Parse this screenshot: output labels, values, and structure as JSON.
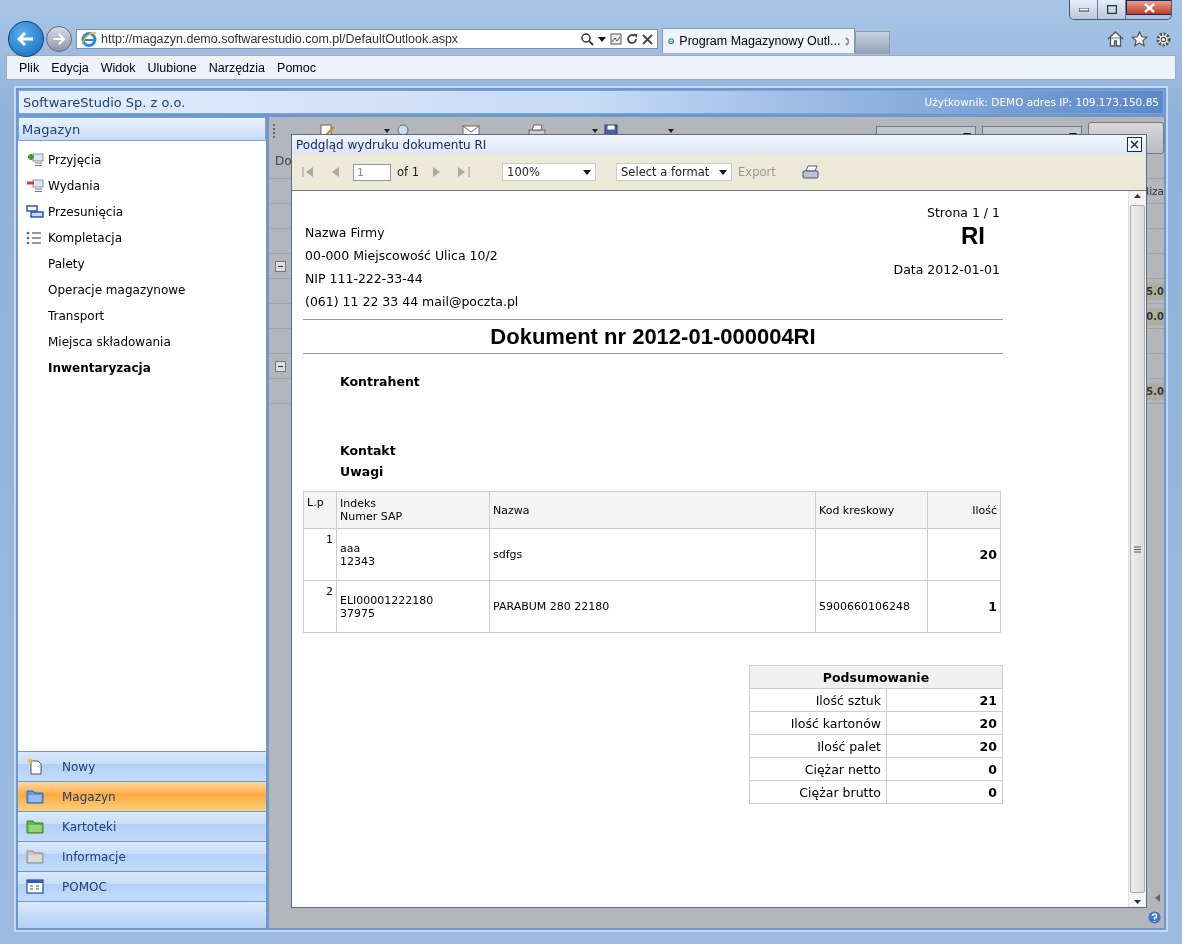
{
  "browser": {
    "address": "http://magazyn.demo.softwarestudio.com.pl/DefaultOutlook.aspx",
    "tab": {
      "title": "Program Magazynowy Outl..."
    },
    "menu": [
      "Plik",
      "Edycja",
      "Widok",
      "Ulubione",
      "Narzędzia",
      "Pomoc"
    ]
  },
  "app": {
    "company": "SoftwareStudio Sp. z o.o.",
    "user_info": "Użytkownik: DEMO adres IP: 109.173.150.85"
  },
  "sidebar": {
    "title": "Magazyn",
    "items": [
      {
        "label": "Przyjęcia",
        "kind": "add",
        "selected": false
      },
      {
        "label": "Wydania",
        "kind": "remove",
        "selected": false
      },
      {
        "label": "Przesunięcia",
        "kind": "move",
        "selected": false
      },
      {
        "label": "Kompletacja",
        "kind": "list",
        "selected": false
      },
      {
        "label": "Palety",
        "kind": "plain",
        "selected": false
      },
      {
        "label": "Operacje magazynowe",
        "kind": "plain",
        "selected": false
      },
      {
        "label": "Transport",
        "kind": "plain",
        "selected": false
      },
      {
        "label": "Miejsca składowania",
        "kind": "plain",
        "selected": false
      },
      {
        "label": "Inwentaryzacja",
        "kind": "plain",
        "selected": true
      }
    ]
  },
  "nav_buttons": [
    {
      "label": "Nowy",
      "kind": "new",
      "selected": false
    },
    {
      "label": "Magazyn",
      "kind": "folder_blue",
      "selected": true
    },
    {
      "label": "Kartoteki",
      "kind": "folder_green",
      "selected": false
    },
    {
      "label": "Informacje",
      "kind": "folder_grey",
      "selected": false
    },
    {
      "label": "POMOC",
      "kind": "window",
      "selected": false
    }
  ],
  "toolbar": {
    "items": [
      {
        "kind": "edit",
        "dropdown": true
      },
      {
        "kind": "preview",
        "dropdown": false
      },
      {
        "kind": "mail",
        "dropdown": false
      },
      {
        "kind": "print",
        "dropdown": true
      },
      {
        "kind": "save",
        "dropdown": true
      }
    ]
  },
  "grid": {
    "header": "Do",
    "header_right": "liza",
    "rows": [
      {
        "kind": "blank"
      },
      {
        "kind": "blank"
      },
      {
        "kind": "group"
      },
      {
        "kind": "value",
        "value": "5.0"
      },
      {
        "kind": "value",
        "value": "0.0"
      },
      {
        "kind": "blank"
      },
      {
        "kind": "group"
      },
      {
        "kind": "value",
        "value": "5.0"
      }
    ]
  },
  "dialog": {
    "title": "Podgląd wydruku dokumentu RI",
    "page": "1",
    "page_count": "of 1",
    "zoom": "100%",
    "format": "Select a format",
    "export": {
      "label": "Export",
      "disabled": true
    },
    "report": {
      "page_label": "Strona 1 / 1",
      "company_lines": [
        "Nazwa Firmy",
        "00-000 Miejscowość Ulica 10/2",
        "NIP 111-222-33-44",
        "(061) 11 22 33 44 mail@poczta.pl"
      ],
      "doc_type": "RI",
      "date": "Data 2012-01-01",
      "heading": "Dokument nr 2012-01-000004RI",
      "labels": [
        "Kontrahent",
        "Kontakt",
        "Uwagi"
      ],
      "columns": [
        {
          "lines": [
            "L.p"
          ]
        },
        {
          "lines": [
            "Indeks",
            "Numer SAP"
          ]
        },
        {
          "lines": [
            "Nazwa"
          ]
        },
        {
          "lines": [
            "Kod kreskowy"
          ]
        },
        {
          "lines": [
            "Ilość"
          ]
        }
      ],
      "rows": [
        {
          "lp": "1",
          "index": "aaa",
          "sap": "12343",
          "name": "sdfgs",
          "qty": "20"
        },
        {
          "lp": "2",
          "index": "ELI00001222180",
          "sap": "37975",
          "name": "PARABUM 280 22180",
          "barcode": "5900660106248",
          "qty": "1"
        }
      ],
      "summary": {
        "title": "Podsumowanie",
        "rows": [
          {
            "label": "Ilość sztuk",
            "value": "21"
          },
          {
            "label": "Ilość kartonów",
            "value": "20"
          },
          {
            "label": "Ilość palet",
            "value": "20"
          },
          {
            "label": "Ciężar netto",
            "value": "0"
          },
          {
            "label": "Ciężar brutto",
            "value": "0"
          }
        ]
      }
    }
  }
}
